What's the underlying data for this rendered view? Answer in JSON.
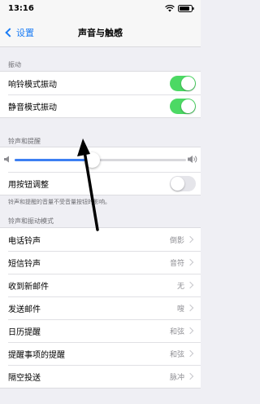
{
  "status_bar": {
    "time": "13:16"
  },
  "nav": {
    "back_label": "设置",
    "title": "声音与触感"
  },
  "vibration": {
    "header": "振动",
    "items": [
      {
        "label": "响铃模式振动",
        "on": true
      },
      {
        "label": "静音模式振动",
        "on": true
      }
    ]
  },
  "ringer": {
    "header": "铃声和提醒",
    "volume_fraction": 0.45,
    "buttons_label": "用按钮调整",
    "buttons_on": false,
    "footnote": "铃声和提醒的音量不受音量按钮的影响。"
  },
  "patterns": {
    "header": "铃声和振动模式",
    "items": [
      {
        "label": "电话铃声",
        "value": "倒影"
      },
      {
        "label": "短信铃声",
        "value": "音符"
      },
      {
        "label": "收到新邮件",
        "value": "无"
      },
      {
        "label": "发送邮件",
        "value": "嗖"
      },
      {
        "label": "日历提醒",
        "value": "和弦"
      },
      {
        "label": "提醒事项的提醒",
        "value": "和弦"
      },
      {
        "label": "隔空投送",
        "value": "脉冲"
      }
    ]
  },
  "colors": {
    "accent": "#1a7cf5",
    "toggle_on": "#4cd964",
    "slider_fill": "#3d7ff2"
  }
}
